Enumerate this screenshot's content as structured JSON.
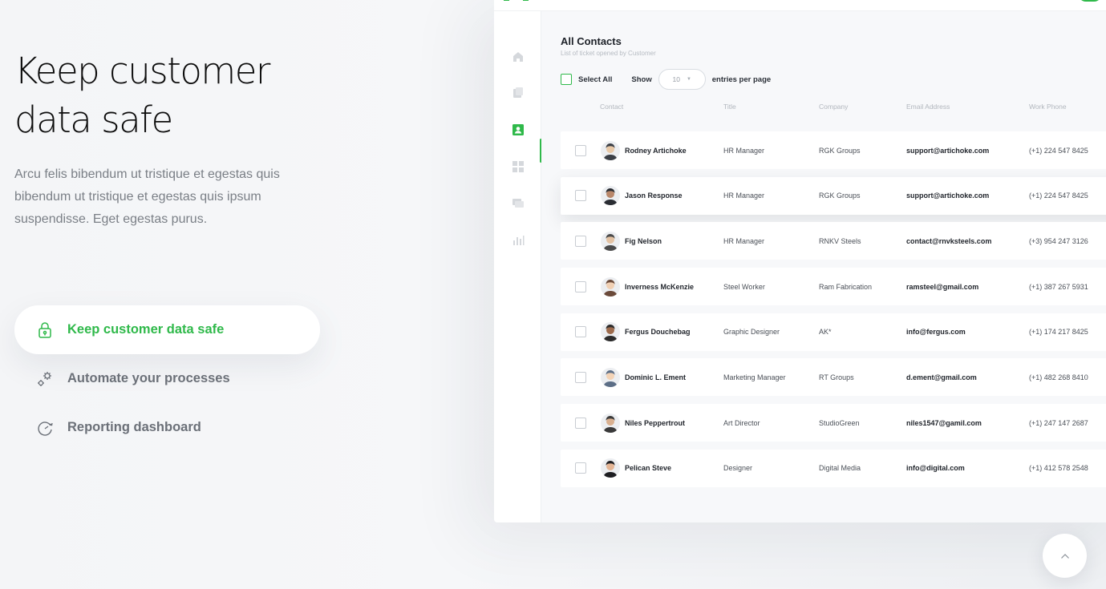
{
  "hero": {
    "title_line1": "Keep customer",
    "title_line2": "data safe",
    "description": "Arcu felis bibendum ut tristique et egestas quis bibendum ut tristique et egestas quis ipsum suspendisse. Eget egestas purus."
  },
  "features": [
    {
      "label": "Keep customer data safe",
      "icon": "lock-icon",
      "active": true
    },
    {
      "label": "Automate your processes",
      "icon": "gears-icon",
      "active": false
    },
    {
      "label": "Reporting dashboard",
      "icon": "gauge-icon",
      "active": false
    }
  ],
  "colors": {
    "accent": "#2fb94a",
    "text_muted": "#7a7f86",
    "background": "#f4f5f7"
  },
  "app": {
    "rail_icons": [
      "home-icon",
      "tickets-icon",
      "contacts-icon",
      "grid-icon",
      "chat-icon",
      "chart-icon"
    ],
    "active_rail_item": "contacts-icon",
    "title": "All Contacts",
    "subtitle": "List of ticket opened by Customer",
    "select_all_label": "Select All",
    "show_label": "Show",
    "entries_value": "10",
    "entries_suffix": "entries per page",
    "columns": [
      "Contact",
      "Title",
      "Company",
      "Email Address",
      "Work Phone"
    ],
    "contacts": [
      {
        "name": "Rodney Artichoke",
        "title": "HR Manager",
        "company": "RGK Groups",
        "email": "support@artichoke.com",
        "phone": "(+1) 224 547 8425"
      },
      {
        "name": "Jason Response",
        "title": "HR Manager",
        "company": "RGK Groups",
        "email": "support@artichoke.com",
        "phone": "(+1) 224 547 8425"
      },
      {
        "name": "Fig Nelson",
        "title": "HR Manager",
        "company": "RNKV Steels",
        "email": "contact@rnvksteels.com",
        "phone": "(+3) 954 247 3126"
      },
      {
        "name": "Inverness McKenzie",
        "title": "Steel Worker",
        "company": "Ram Fabrication",
        "email": "ramsteel@gmail.com",
        "phone": "(+1) 387 267 5931"
      },
      {
        "name": "Fergus Douchebag",
        "title": "Graphic Designer",
        "company": "AK*",
        "email": "info@fergus.com",
        "phone": "(+1) 174 217 8425"
      },
      {
        "name": "Dominic L. Ement",
        "title": "Marketing Manager",
        "company": "RT Groups",
        "email": "d.ement@gmail.com",
        "phone": "(+1) 482 268 8410"
      },
      {
        "name": "Niles Peppertrout",
        "title": "Art Director",
        "company": "StudioGreen",
        "email": "niles1547@gamil.com",
        "phone": "(+1) 247 147 2687"
      },
      {
        "name": "Pelican Steve",
        "title": "Designer",
        "company": "Digital Media",
        "email": "info@digital.com",
        "phone": "(+1) 412 578 2548"
      }
    ]
  }
}
